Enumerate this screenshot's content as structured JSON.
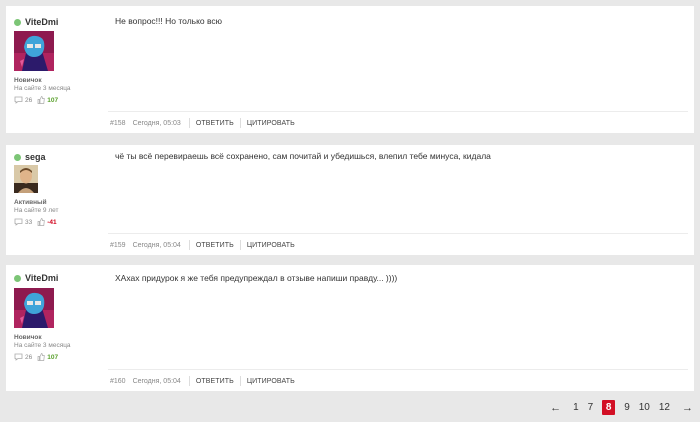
{
  "posts": [
    {
      "username": "ViteDmi",
      "rank": "Новичок",
      "since": "На сайте 3 месяца",
      "messages": "26",
      "reputation": "107",
      "text": "Не вопрос!!! Но только всю",
      "number": "#158",
      "date": "Сегодня, 05:03"
    },
    {
      "username": "sega",
      "rank": "Активный",
      "since": "На сайте 9 лет",
      "messages": "33",
      "reputation": "-41",
      "text": "чё ты всё перевираешь всё сохранено, сам почитай и убедишься, влепил тебе минуса, кидала",
      "number": "#159",
      "date": "Сегодня, 05:04"
    },
    {
      "username": "ViteDmi",
      "rank": "Новичок",
      "since": "На сайте 3 месяца",
      "messages": "26",
      "reputation": "107",
      "text": "ХАхах придурок я же тебя предупреждал в отзыве напиши правду... ))))",
      "number": "#160",
      "date": "Сегодня, 05:04"
    }
  ],
  "actions": {
    "reply": "Ответить",
    "quote": "Цитировать"
  },
  "pagination": {
    "prev": "←",
    "pages": [
      "1",
      "7",
      "8",
      "9",
      "10",
      "12"
    ],
    "current": "8",
    "next": "→"
  },
  "colors": {
    "online": "#7cc576",
    "positive": "#5aa02c",
    "negative": "#d0021b",
    "current_page": "#d20f24"
  }
}
